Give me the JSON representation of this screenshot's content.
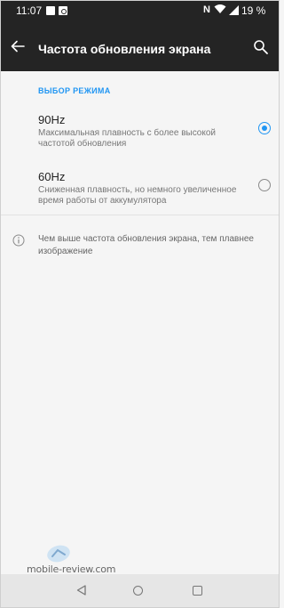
{
  "status_bar": {
    "time": "11:07",
    "battery": "19 %",
    "nfc": "N"
  },
  "app_bar": {
    "title": "Частота обновления экрана"
  },
  "section": {
    "header": "ВЫБОР РЕЖИМА",
    "options": [
      {
        "title": "90Hz",
        "description": "Максимальная плавность с более высокой частотой обновления",
        "selected": true
      },
      {
        "title": "60Hz",
        "description": "Сниженная плавность, но немного увеличенное время работы от аккумулятора",
        "selected": false
      }
    ]
  },
  "info": {
    "text": "Чем выше частота обновления экрана, тем плавнее изображение"
  },
  "watermark": {
    "text": "mobile-review.com"
  },
  "colors": {
    "accent": "#2196f3",
    "bar": "#242424"
  }
}
